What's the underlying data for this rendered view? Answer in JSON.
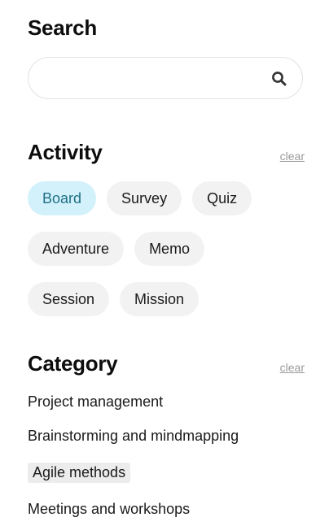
{
  "search": {
    "title": "Search",
    "placeholder": "",
    "value": ""
  },
  "activity": {
    "title": "Activity",
    "clear_label": "clear",
    "chips": [
      {
        "label": "Board",
        "selected": true
      },
      {
        "label": "Survey",
        "selected": false
      },
      {
        "label": "Quiz",
        "selected": false
      },
      {
        "label": "Adventure",
        "selected": false
      },
      {
        "label": "Memo",
        "selected": false
      },
      {
        "label": "Session",
        "selected": false
      },
      {
        "label": "Mission",
        "selected": false
      }
    ]
  },
  "category": {
    "title": "Category",
    "clear_label": "clear",
    "items": [
      {
        "label": "Project management",
        "selected": false
      },
      {
        "label": "Brainstorming and mindmapping",
        "selected": false
      },
      {
        "label": "Agile methods",
        "selected": true
      },
      {
        "label": "Meetings and workshops",
        "selected": false
      }
    ]
  },
  "colors": {
    "chip_background": "#f2f2f2",
    "chip_selected_background": "#d2f1fb",
    "chip_selected_text": "#1f6f86",
    "clear_link": "#9a9a9a",
    "category_selected_background": "#ececec"
  },
  "icons": {
    "search_button": "search-icon"
  }
}
